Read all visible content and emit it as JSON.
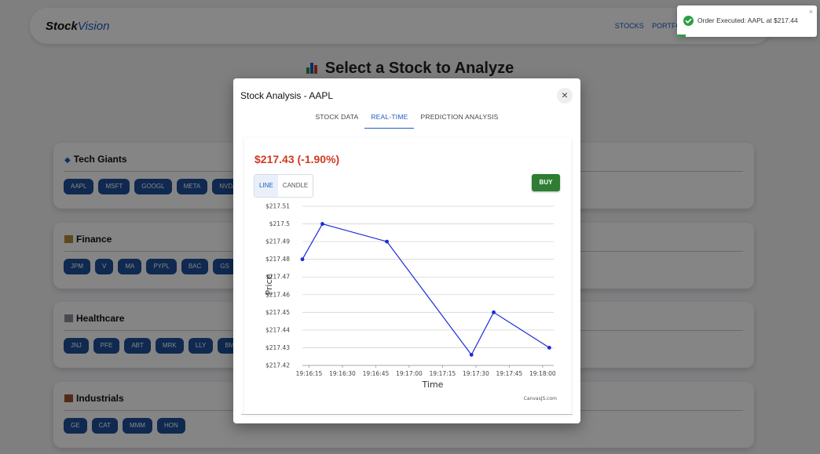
{
  "app": {
    "brand_main": "Stock",
    "brand_accent": "Vision",
    "nav": [
      "STOCKS",
      "PORTFOLIO"
    ]
  },
  "page": {
    "title": "Select a Stock to Analyze",
    "sections": [
      {
        "title": "Tech Giants",
        "icon": "diamond-icon",
        "tickers": [
          "AAPL",
          "MSFT",
          "GOOGL",
          "META",
          "NVDA"
        ]
      },
      {
        "title": "Finance",
        "icon": "bank-icon",
        "tickers": [
          "JPM",
          "V",
          "MA",
          "PYPL",
          "BAC",
          "GS"
        ]
      },
      {
        "title": "Healthcare",
        "icon": "hospital-icon",
        "tickers": [
          "JNJ",
          "PFE",
          "ABT",
          "MRK",
          "LLY",
          "BMY"
        ]
      },
      {
        "title": "Industrials",
        "icon": "factory-icon",
        "tickers": [
          "GE",
          "CAT",
          "MMM",
          "HON"
        ]
      }
    ]
  },
  "modal": {
    "title": "Stock Analysis - AAPL",
    "close_label": "×",
    "tabs": [
      {
        "label": "STOCK DATA",
        "active": false
      },
      {
        "label": "REAL-TIME",
        "active": true
      },
      {
        "label": "PREDICTION ANALYSIS",
        "active": false
      }
    ],
    "price_text": "$217.43 (-1.90%)",
    "chart_toggle": {
      "line": "LINE",
      "candle": "CANDLE",
      "selected": "LINE"
    },
    "buy_label": "BUY",
    "watermark": "CanvasJS.com"
  },
  "chart_data": {
    "type": "line",
    "xlabel": "Time",
    "ylabel": "Price",
    "y_tick_labels": [
      "$217.51",
      "$217.5",
      "$217.49",
      "$217.48",
      "$217.47",
      "$217.46",
      "$217.45",
      "$217.44",
      "$217.43",
      "$217.42"
    ],
    "x_tick_labels": [
      "19:16:15",
      "19:16:30",
      "19:16:45",
      "19:17:00",
      "19:17:15",
      "19:17:30",
      "19:17:45",
      "19:18:00"
    ],
    "ylim": [
      217.42,
      217.51
    ],
    "xlim": [
      "19:16:12",
      "19:18:05"
    ],
    "grid": true,
    "series": [
      {
        "color": "#1a2bd6",
        "points": [
          {
            "x": "19:16:12",
            "y": 217.48
          },
          {
            "x": "19:16:21",
            "y": 217.5
          },
          {
            "x": "19:16:50",
            "y": 217.49
          },
          {
            "x": "19:17:28",
            "y": 217.426
          },
          {
            "x": "19:17:38",
            "y": 217.45
          },
          {
            "x": "19:18:03",
            "y": 217.43
          }
        ]
      }
    ]
  },
  "toast": {
    "message": "Order Executed: AAPL at $217.44",
    "close_label": "×",
    "progress": 0.06
  },
  "colors": {
    "accent": "#1e5bbf",
    "price_down": "#d13a22",
    "buy": "#2e7d32",
    "chip": "#1d4f9a",
    "success": "#2e9e44",
    "line": "#1a2bd6"
  }
}
